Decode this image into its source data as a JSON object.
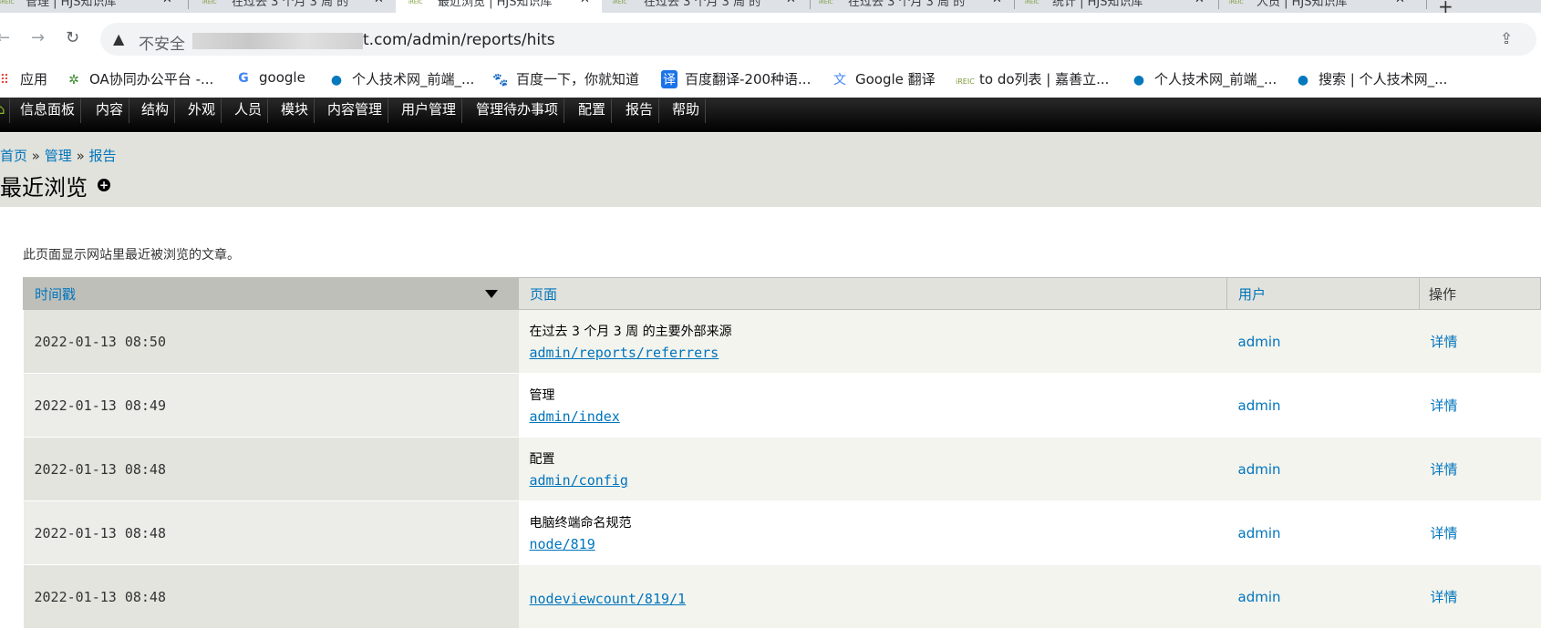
{
  "browser": {
    "tabs": [
      {
        "title": "管理 | HJS知识库",
        "active": false
      },
      {
        "title": "在过去 3 个月 3 周 的",
        "active": false
      },
      {
        "title": "最近浏览 | HJS知识库",
        "active": true
      },
      {
        "title": "在过去 3 个月 3 周 的",
        "active": false
      },
      {
        "title": "在过去 3 个月 3 周 的",
        "active": false
      },
      {
        "title": "统计 | HJS知识库",
        "active": false
      },
      {
        "title": "人员 | HJS知识库",
        "active": false
      }
    ],
    "favicon_text": "iREIC",
    "new_tab": "+",
    "security_label": "不安全",
    "url": "t.com/admin/reports/hits",
    "bookmarks": [
      {
        "label": "应用",
        "icon": "apps-icon"
      },
      {
        "label": "OA协同办公平台 -...",
        "icon": "oa-icon"
      },
      {
        "label": "google",
        "icon": "google-icon"
      },
      {
        "label": "个人技术网_前端_...",
        "icon": "drupal-icon"
      },
      {
        "label": "百度一下，你就知道",
        "icon": "baidu-icon"
      },
      {
        "label": "百度翻译-200种语...",
        "icon": "translate-icon"
      },
      {
        "label": "Google 翻译",
        "icon": "google-translate-icon"
      },
      {
        "label": "to do列表 | 嘉善立...",
        "icon": "ireic-icon"
      },
      {
        "label": "个人技术网_前端_...",
        "icon": "drupal-icon"
      },
      {
        "label": "搜索 | 个人技术网_...",
        "icon": "drupal-icon"
      }
    ]
  },
  "toolbar": {
    "items": [
      "信息面板",
      "内容",
      "结构",
      "外观",
      "人员",
      "模块",
      "内容管理",
      "用户管理",
      "管理待办事项",
      "配置",
      "报告",
      "帮助"
    ]
  },
  "breadcrumb": {
    "home": "首页",
    "sep": "»",
    "admin": "管理",
    "reports": "报告"
  },
  "page": {
    "title": "最近浏览",
    "description": "此页面显示网站里最近被浏览的文章。"
  },
  "table": {
    "headers": {
      "timestamp": "时间戳",
      "page": "页面",
      "user": "用户",
      "operations": "操作"
    },
    "rows": [
      {
        "timestamp": "2022-01-13 08:50",
        "title": "在过去 3 个月 3 周 的主要外部来源",
        "path": "admin/reports/referrers",
        "user": "admin",
        "op": "详情"
      },
      {
        "timestamp": "2022-01-13 08:49",
        "title": "管理",
        "path": "admin/index",
        "user": "admin",
        "op": "详情"
      },
      {
        "timestamp": "2022-01-13 08:48",
        "title": "配置",
        "path": "admin/config",
        "user": "admin",
        "op": "详情"
      },
      {
        "timestamp": "2022-01-13 08:48",
        "title": "电脑终端命名规范",
        "path": "node/819",
        "user": "admin",
        "op": "详情"
      },
      {
        "timestamp": "2022-01-13 08:48",
        "title": "",
        "path": "nodeviewcount/819/1",
        "user": "admin",
        "op": "详情"
      }
    ]
  }
}
